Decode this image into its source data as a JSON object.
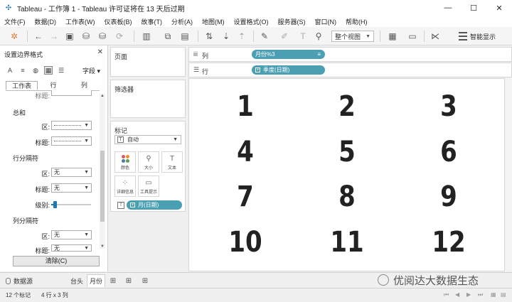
{
  "window": {
    "title": "Tableau - 工作簿 1 - Tableau 许可证将在 13 天后过期",
    "minimize": "—",
    "maximize": "☐",
    "close": "✕"
  },
  "menu": [
    "文件(F)",
    "数据(D)",
    "工作表(W)",
    "仪表板(B)",
    "故事(T)",
    "分析(A)",
    "地图(M)",
    "设置格式(O)",
    "服务器(S)",
    "窗口(N)",
    "帮助(H)"
  ],
  "toolbar": {
    "view_mode": "整个视图",
    "smart_show": "智能显示"
  },
  "format_panel": {
    "title": "设置边界格式",
    "field_label": "字段",
    "tabs": [
      "工作表",
      "行",
      "列"
    ],
    "active_tab": "工作表",
    "partial_label": "标题:",
    "sections": [
      {
        "name": "总和",
        "rows": [
          {
            "label": "区:"
          },
          {
            "label": "标题:"
          }
        ]
      },
      {
        "name": "行分隔符",
        "rows": [
          {
            "label": "区:",
            "value": "无"
          },
          {
            "label": "标题:",
            "value": "无"
          },
          {
            "label": "级别:",
            "slider": 0.05
          }
        ]
      },
      {
        "name": "列分隔符",
        "rows": [
          {
            "label": "区:",
            "value": "无"
          },
          {
            "label": "标题:",
            "value": "无"
          }
        ]
      }
    ],
    "clear_button": "清除(C)"
  },
  "cards": {
    "pages": "页面",
    "filters": "筛选器",
    "marks": {
      "title": "标记",
      "type": "自动",
      "buttons": [
        "颜色",
        "大小",
        "文本",
        "详细信息",
        "工具提示"
      ],
      "pill": "月(日期)"
    }
  },
  "shelves": {
    "columns": {
      "label": "列",
      "pill": "月份%3"
    },
    "rows": {
      "label": "行",
      "pill": "季度(日期)"
    }
  },
  "view": {
    "cells": [
      "1",
      "2",
      "3",
      "4",
      "5",
      "6",
      "7",
      "8",
      "9",
      "10",
      "11",
      "12"
    ]
  },
  "bottom": {
    "data_source": "数据源",
    "sheets": [
      "台头",
      "月份"
    ],
    "active_sheet": "月份",
    "watermark": "优阅达大数据生态"
  },
  "status": {
    "marks": "12 个标记",
    "dims": "4 行 x 3 列"
  },
  "colors": {
    "pill": "#4a9fb3",
    "accent": "#1f77b4"
  }
}
